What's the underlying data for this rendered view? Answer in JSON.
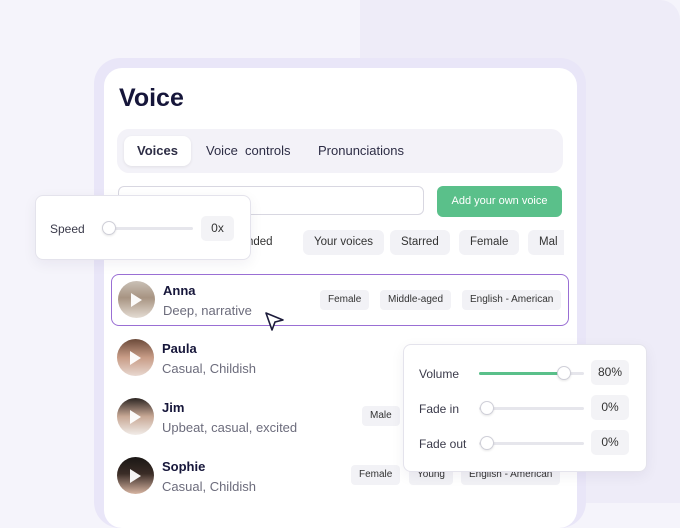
{
  "title": "Voice",
  "tabs": [
    {
      "label": "Voices"
    },
    {
      "label": "Voice  controls"
    },
    {
      "label": "Pronunciations"
    }
  ],
  "add_voice_button": "Add your own voice",
  "filters": [
    "mended",
    "Your voices",
    "Starred",
    "Female",
    "Mal"
  ],
  "speed": {
    "label": "Speed",
    "value": "0x",
    "level": 0
  },
  "voices": [
    {
      "name": "Anna",
      "desc": "Deep, narrative",
      "tags": [
        "Female",
        "Middle-aged",
        "English - American"
      ]
    },
    {
      "name": "Paula",
      "desc": "Casual, Childish",
      "tags": []
    },
    {
      "name": "Jim",
      "desc": "Upbeat, casual, excited",
      "tags": [
        "Male"
      ]
    },
    {
      "name": "Sophie",
      "desc": "Casual, Childish",
      "tags": [
        "Female",
        "Young",
        "English - American"
      ]
    }
  ],
  "audio": {
    "volume": {
      "label": "Volume",
      "value": "80%",
      "level": 0.8
    },
    "fade_in": {
      "label": "Fade in",
      "value": "0%",
      "level": 0
    },
    "fade_out": {
      "label": "Fade out",
      "value": "0%",
      "level": 0
    }
  },
  "colors": {
    "accent": "#5ac08a",
    "selection": "#9a6fd4",
    "title": "#16163a"
  },
  "icons": [
    "play-icon",
    "cursor-arrow-icon"
  ]
}
